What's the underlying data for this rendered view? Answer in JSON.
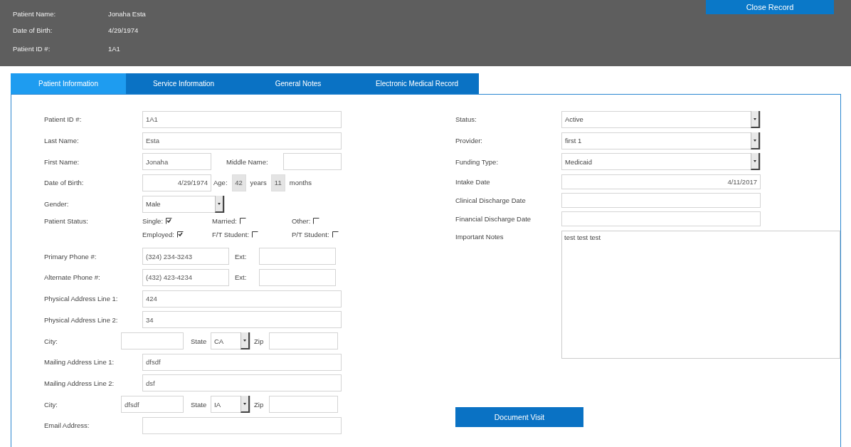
{
  "header": {
    "close_button": "Close Record",
    "info": [
      {
        "label": "Patient Name:",
        "value": "Jonaha Esta"
      },
      {
        "label": "Date of Birth:",
        "value": "4/29/1974"
      },
      {
        "label": "Patient ID #:",
        "value": "1A1"
      }
    ]
  },
  "tabs": [
    {
      "label": "Patient Information",
      "selected": true
    },
    {
      "label": "Service Information",
      "selected": false
    },
    {
      "label": "General Notes",
      "selected": false
    },
    {
      "label": "Electronic Medical Record",
      "selected": false
    }
  ],
  "left_form": [
    {
      "kind": "text",
      "label": "Patient ID #:",
      "value": "1A1"
    },
    {
      "kind": "text",
      "label": "Last Name:",
      "value": "Esta"
    },
    {
      "kind": "name",
      "label": "First Name:",
      "value": "Jonaha",
      "middle_label": "Middle Name:"
    },
    {
      "kind": "dob",
      "label": "Date of Birth:",
      "value": "4/29/1974",
      "age_label": "Age:",
      "years": "42",
      "years_label": "years",
      "months": "11",
      "months_label": "months"
    },
    {
      "kind": "select",
      "label": "Gender:",
      "value": "Male"
    },
    {
      "kind": "checks",
      "label": "Patient Status:",
      "options": [
        {
          "label": "Single:",
          "checked": true
        },
        {
          "label": "Married:",
          "checked": false
        },
        {
          "label": "Other:",
          "checked": false
        },
        {
          "label": "Employed:",
          "checked": true
        },
        {
          "label": "F/T Student:",
          "checked": false
        },
        {
          "label": "P/T Student:",
          "checked": false
        }
      ]
    },
    {
      "kind": "phone",
      "label": "Primary Phone #:",
      "value": "(324) 234-3243",
      "ext_label": "Ext:"
    },
    {
      "kind": "phone",
      "label": "Alternate Phone #:",
      "value": "(432) 423-4234",
      "ext_label": "Ext:"
    },
    {
      "kind": "text",
      "label": "Physical Address Line 1:",
      "value": "424"
    },
    {
      "kind": "text",
      "label": "Physical Address Line 2:",
      "value": "34"
    },
    {
      "kind": "city",
      "label": "City:",
      "state_label": "State",
      "state": "CA",
      "zip_label": "Zip"
    },
    {
      "kind": "text",
      "label": "Mailing Address Line 1:",
      "value": "dfsdf"
    },
    {
      "kind": "text",
      "label": "Mailing Address Line 2:",
      "value": "dsf"
    },
    {
      "kind": "city",
      "label": "City:",
      "value": "dfsdf",
      "state_label": "State",
      "state": "IA",
      "zip_label": "Zip"
    },
    {
      "kind": "text",
      "label": "Email Address:"
    }
  ],
  "right_form": [
    {
      "kind": "select",
      "label": "Status:",
      "value": "Active"
    },
    {
      "kind": "select",
      "label": "Provider:",
      "value": "first 1"
    },
    {
      "kind": "select",
      "label": "Funding Type:",
      "value": "Medicaid"
    },
    {
      "kind": "date",
      "label": "Intake Date",
      "value": "4/11/2017"
    },
    {
      "kind": "date",
      "label": "Clinical Discharge Date"
    },
    {
      "kind": "date",
      "label": "Financial Discharge Date"
    },
    {
      "kind": "notes",
      "label": "Important Notes",
      "value": "test test test"
    }
  ],
  "document_button": "Document Visit"
}
